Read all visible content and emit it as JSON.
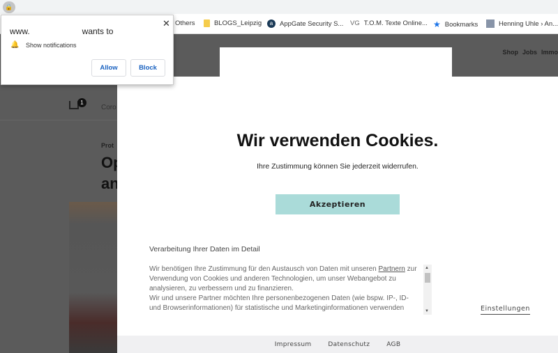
{
  "browser": {
    "bookmarks": [
      {
        "label": "Others",
        "icon": "folder-icon"
      },
      {
        "label": "BLOGS_Leipzig",
        "icon": "folder-icon"
      },
      {
        "label": "AppGate Security S...",
        "icon": "appgate-icon"
      },
      {
        "label": "T.O.M. Texte Online...",
        "icon": "vg-icon",
        "prefix": "VG"
      },
      {
        "label": "Bookmarks",
        "icon": "star-icon"
      },
      {
        "label": "Henning Uhle › An...",
        "icon": "thumbnail-icon"
      }
    ]
  },
  "permission_popup": {
    "title_prefix": "www.",
    "title_suffix": "wants to",
    "permission": "Show notifications",
    "allow": "Allow",
    "block": "Block",
    "close": "✕"
  },
  "page": {
    "top_nav": [
      "Shop",
      "Jobs",
      "Immo"
    ],
    "home_badge": "1",
    "nav_item": "Coro",
    "kicker": "Prot",
    "headline": "Op an"
  },
  "cookie_modal": {
    "title": "Wir verwenden Cookies.",
    "subtitle": "Ihre Zustimmung können Sie jederzeit widerrufen.",
    "accept": "Akzeptieren",
    "detail_title": "Verarbeitung Ihrer Daten im Detail",
    "detail_text_1": "Wir benötigen Ihre Zustimmung für den Austausch von Daten mit unseren ",
    "detail_link": "Partnern",
    "detail_text_2": " zur Verwendung von Cookies und anderen Technologien, um unser Webangebot zu analysieren, zu verbessern und zu finanzieren.",
    "detail_text_3": "Wir und unsere Partner möchten Ihre personenbezogenen Daten (wie bspw. IP-, ID- und Browserinformationen) für statistische und Marketinginformationen verwenden",
    "settings": "Einstellungen",
    "footer": [
      "Impressum",
      "Datenschutz",
      "AGB"
    ],
    "accent_color": "#aadbd9"
  }
}
